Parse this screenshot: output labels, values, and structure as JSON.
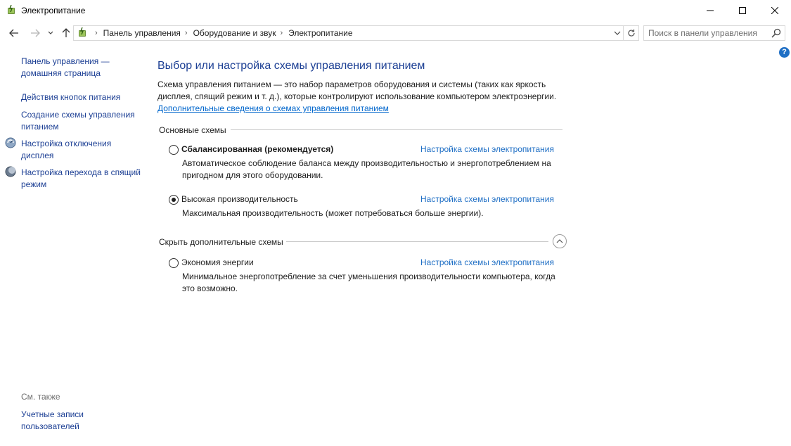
{
  "window": {
    "title": "Электропитание"
  },
  "address": {
    "crumbs": [
      "Панель управления",
      "Оборудование и звук",
      "Электропитание"
    ]
  },
  "search": {
    "placeholder": "Поиск в панели управления"
  },
  "help": {
    "label": "?"
  },
  "sidebar": {
    "home_link": "Панель управления — домашняя страница",
    "items": [
      {
        "label": "Действия кнопок питания",
        "icon": "none"
      },
      {
        "label": "Создание схемы управления питанием",
        "icon": "none"
      },
      {
        "label": "Настройка отключения дисплея",
        "icon": "monitor-icon"
      },
      {
        "label": "Настройка перехода в спящий режим",
        "icon": "moon-icon"
      }
    ],
    "see_also_label": "См. также",
    "see_also_items": [
      {
        "label": "Учетные записи пользователей"
      }
    ]
  },
  "main": {
    "title": "Выбор или настройка схемы управления питанием",
    "intro": "Схема управления питанием — это набор параметров оборудования и системы (таких как яркость дисплея, спящий режим и т. д.), которые контролируют использование компьютером электроэнергии.",
    "intro_link": "Дополнительные сведения о схемах управления питанием",
    "primary_group_label": "Основные схемы",
    "additional_group_label": "Скрыть дополнительные схемы",
    "plans": [
      {
        "name": "Сбалансированная (рекомендуется)",
        "selected": false,
        "configure_link": "Настройка схемы электропитания",
        "description": "Автоматическое соблюдение баланса между производительностью и энергопотреблением на пригодном для этого оборудовании."
      },
      {
        "name": "Высокая производительность",
        "selected": true,
        "configure_link": "Настройка схемы электропитания",
        "description": "Максимальная производительность (может потребоваться больше энергии)."
      },
      {
        "name": "Экономия энергии",
        "selected": false,
        "configure_link": "Настройка схемы электропитания",
        "description": "Минимальное энергопотребление за счет уменьшения производительности компьютера, когда это возможно."
      }
    ]
  },
  "colors": {
    "title_blue": "#1c3f94",
    "link_blue": "#1f6fc5",
    "help_blue": "#1f6fc5"
  }
}
